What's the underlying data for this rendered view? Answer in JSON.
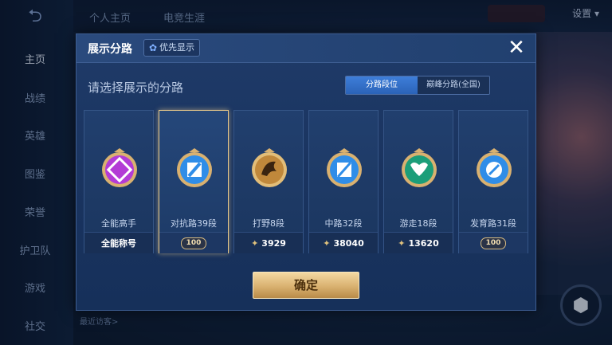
{
  "top_tabs": [
    "个人主页",
    "电竞生涯"
  ],
  "settings_label": "设置",
  "notification": "",
  "sidebar": {
    "items": [
      {
        "label": "主页"
      },
      {
        "label": "战绩"
      },
      {
        "label": "英雄"
      },
      {
        "label": "图鉴"
      },
      {
        "label": "荣誉"
      },
      {
        "label": "护卫队"
      },
      {
        "label": "游戏"
      },
      {
        "label": "社交"
      }
    ]
  },
  "bottom_bar": {
    "recent_visitors": "最近访客>"
  },
  "modal": {
    "title": "展示分路",
    "priority_label": "优先显示",
    "subtitle": "请选择展示的分路",
    "segments": [
      {
        "label": "分路段位",
        "active": true
      },
      {
        "label": "巅峰分路(全国)",
        "active": false
      }
    ],
    "cards": [
      {
        "label": "全能高手",
        "footer": "全能称号",
        "badge_color": "#b33bd6",
        "badge": "all-round-icon",
        "selected": false
      },
      {
        "label": "对抗路39段",
        "footer": "100",
        "footer_type": "level",
        "badge_color": "#2f8de8",
        "badge": "sword-icon",
        "selected": true
      },
      {
        "label": "打野8段",
        "footer": "3929",
        "footer_type": "score",
        "badge_color": "#c0883b",
        "badge": "dragon-icon",
        "selected": false
      },
      {
        "label": "中路32段",
        "footer": "38040",
        "footer_type": "score",
        "badge_color": "#2f8de8",
        "badge": "staff-icon",
        "selected": false
      },
      {
        "label": "游走18段",
        "footer": "13620",
        "footer_type": "score",
        "badge_color": "#1c9e79",
        "badge": "wings-icon",
        "selected": false
      },
      {
        "label": "发育路31段",
        "footer": "100",
        "footer_type": "level",
        "badge_color": "#2f8de8",
        "badge": "bow-icon",
        "selected": false
      }
    ],
    "confirm_label": "确定",
    "accent_gold": "#e8c98a"
  }
}
